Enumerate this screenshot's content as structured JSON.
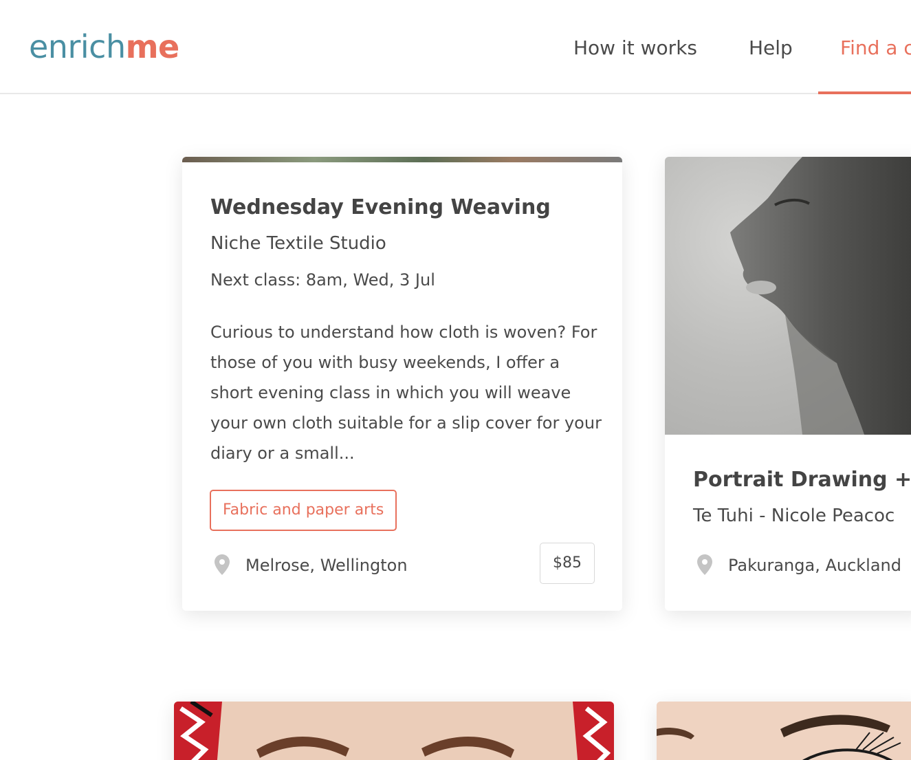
{
  "header": {
    "logo_part1": "enrich",
    "logo_part2": "me",
    "nav": {
      "how_it_works": "How it works",
      "help": "Help",
      "find": "Find a c"
    }
  },
  "cards": [
    {
      "title": "Wednesday Evening Weaving",
      "provider": "Niche Textile Studio",
      "next_class": "Next class: 8am, Wed, 3 Jul",
      "description": "Curious to understand how cloth is woven? For those of you with busy weekends, I offer a short evening class in which you will weave your own cloth suitable for a slip cover for your diary or a small...",
      "tag": "Fabric and paper arts",
      "location": "Melrose, Wellington",
      "price": "$85"
    },
    {
      "title": "Portrait Drawing + I",
      "provider": "Te Tuhi - Nicole Peacoc",
      "location": "Pakuranga, Auckland"
    }
  ],
  "colors": {
    "brand_teal": "#4a8fa3",
    "brand_coral": "#e8705c",
    "text": "#4a4a4a"
  },
  "icons": {
    "location": "map-pin-icon"
  }
}
